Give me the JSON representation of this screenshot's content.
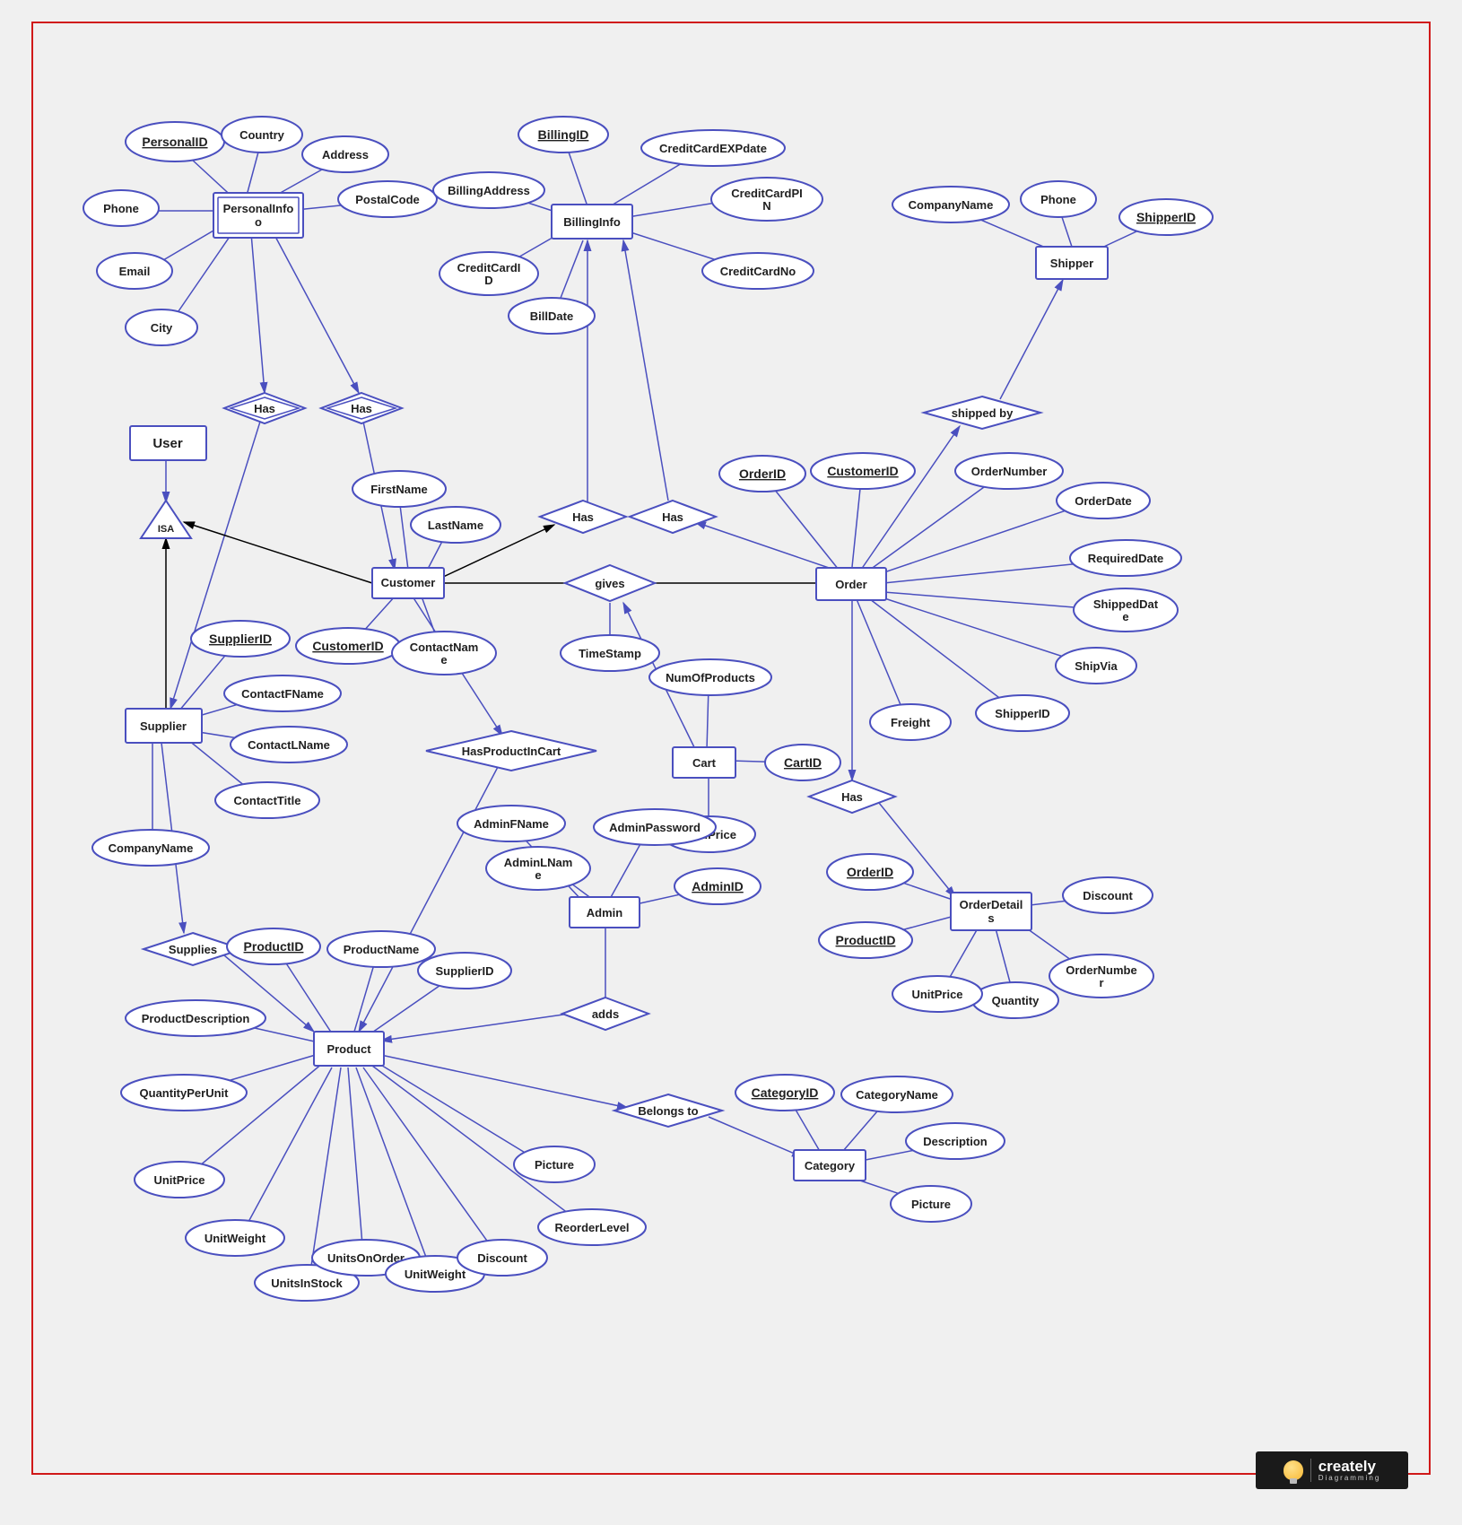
{
  "brand": {
    "name": "creately",
    "tagline": "Diagramming"
  },
  "entities": {
    "PersonalInfo": {
      "label": "PersonalInfo",
      "weak": true,
      "attrs": [
        "PersonalID",
        "Country",
        "Address",
        "PostalCode",
        "Phone",
        "Email",
        "City"
      ],
      "keys": [
        "PersonalID"
      ]
    },
    "User": {
      "label": "User"
    },
    "Customer": {
      "label": "Customer",
      "attrs": [
        "FirstName",
        "LastName",
        "CustomerID",
        "ContactName"
      ],
      "keys": [
        "CustomerID"
      ]
    },
    "Supplier": {
      "label": "Supplier",
      "attrs": [
        "SupplierID",
        "ContactFName",
        "ContactLName",
        "ContactTitle",
        "CompanyName"
      ],
      "keys": [
        "SupplierID"
      ]
    },
    "BillingInfo": {
      "label": "BillingInfo",
      "attrs": [
        "BillingID",
        "CreditCardEXPdate",
        "CreditCardPIN",
        "CreditCardNo",
        "BillingAddress",
        "CreditCardID",
        "BillDate"
      ],
      "keys": [
        "BillingID"
      ]
    },
    "Shipper": {
      "label": "Shipper",
      "attrs": [
        "CompanyName",
        "Phone",
        "ShipperID"
      ],
      "keys": [
        "ShipperID"
      ]
    },
    "Order": {
      "label": "Order",
      "attrs": [
        "OrderID",
        "CustomerID",
        "OrderNumber",
        "OrderDate",
        "RequiredDate",
        "ShippedDate",
        "ShipVia",
        "ShipperID",
        "Freight"
      ],
      "keys": [
        "OrderID",
        "CustomerID"
      ]
    },
    "Cart": {
      "label": "Cart",
      "attrs": [
        "NumOfProducts",
        "CartID",
        "TotalPrice"
      ],
      "keys": [
        "CartID"
      ]
    },
    "Admin": {
      "label": "Admin",
      "attrs": [
        "AdminFName",
        "AdminLName",
        "AdminPassword",
        "AdminID"
      ],
      "keys": [
        "AdminID"
      ]
    },
    "OrderDetails": {
      "label": "OrderDetails",
      "attrs": [
        "OrderID",
        "ProductID",
        "Discount",
        "OrderNumber",
        "Quantity",
        "UnitPrice"
      ],
      "keys": [
        "OrderID",
        "ProductID"
      ]
    },
    "Product": {
      "label": "Product",
      "attrs": [
        "ProductID",
        "ProductName",
        "SupplierID",
        "ProductDescription",
        "QuantityPerUnit",
        "UnitPrice",
        "UnitWeight",
        "UnitsInStock",
        "UnitsOnOrder",
        "UnitWeight",
        "Discount",
        "ReorderLevel",
        "Picture"
      ],
      "keys": [
        "ProductID"
      ]
    },
    "Category": {
      "label": "Category",
      "attrs": [
        "CategoryID",
        "CategoryName",
        "Description",
        "Picture"
      ],
      "keys": [
        "CategoryID"
      ]
    }
  },
  "relationships": {
    "Has1": "Has",
    "Has2": "Has",
    "Has3": "Has",
    "Has4": "Has",
    "Has5": "Has",
    "gives": "gives",
    "HasProductInCart": "HasProductInCart",
    "Supplies": "Supplies",
    "adds": "adds",
    "BelongsTo": "Belongs to",
    "shippedBy": "shipped by",
    "ISA": "ISA",
    "TimeStamp": "TimeStamp"
  }
}
